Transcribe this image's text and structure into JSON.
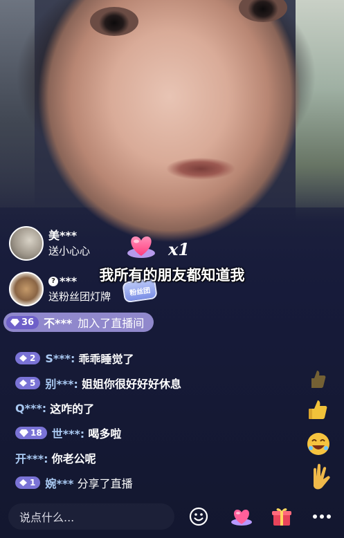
{
  "gifts": [
    {
      "user": "美***",
      "action": "送小心心",
      "has_q_badge": false
    },
    {
      "user": "***",
      "action": "送粉丝团灯牌",
      "has_q_badge": true
    }
  ],
  "gift_count": "x1",
  "fan_badge_label": "粉丝团",
  "subtitle": "我所有的朋友都知道我",
  "join": {
    "level": "36",
    "user": "不***",
    "text": "加入了直播间"
  },
  "chat": [
    {
      "level": "2",
      "user": "S***:",
      "message": "乖乖睡觉了"
    },
    {
      "level": "5",
      "user": "别***:",
      "message": "姐姐你很好好好休息"
    },
    {
      "level": "",
      "user": "Q***:",
      "message": "这咋的了"
    },
    {
      "level": "18",
      "user": "世***:",
      "message": "喝多啦"
    },
    {
      "level": "",
      "user": "开***:",
      "message": "你老公呢"
    },
    {
      "level": "1",
      "user": "婉***",
      "message": "分享了直播"
    }
  ],
  "input_placeholder": "说点什么...",
  "icons": [
    "emoji-icon",
    "heart-gift-icon",
    "gift-box-icon",
    "more-icon",
    "diamond-level-icon",
    "thumbs-up-icon",
    "laugh-emoji-icon",
    "hand-sign-icon"
  ],
  "colors": {
    "level_badge": "#7a73d6",
    "join_pill": "#a69ce6",
    "chat_user": "#a9c9f2",
    "gift_red": "#e8445a",
    "heart_pink": "#ff5f9a"
  }
}
